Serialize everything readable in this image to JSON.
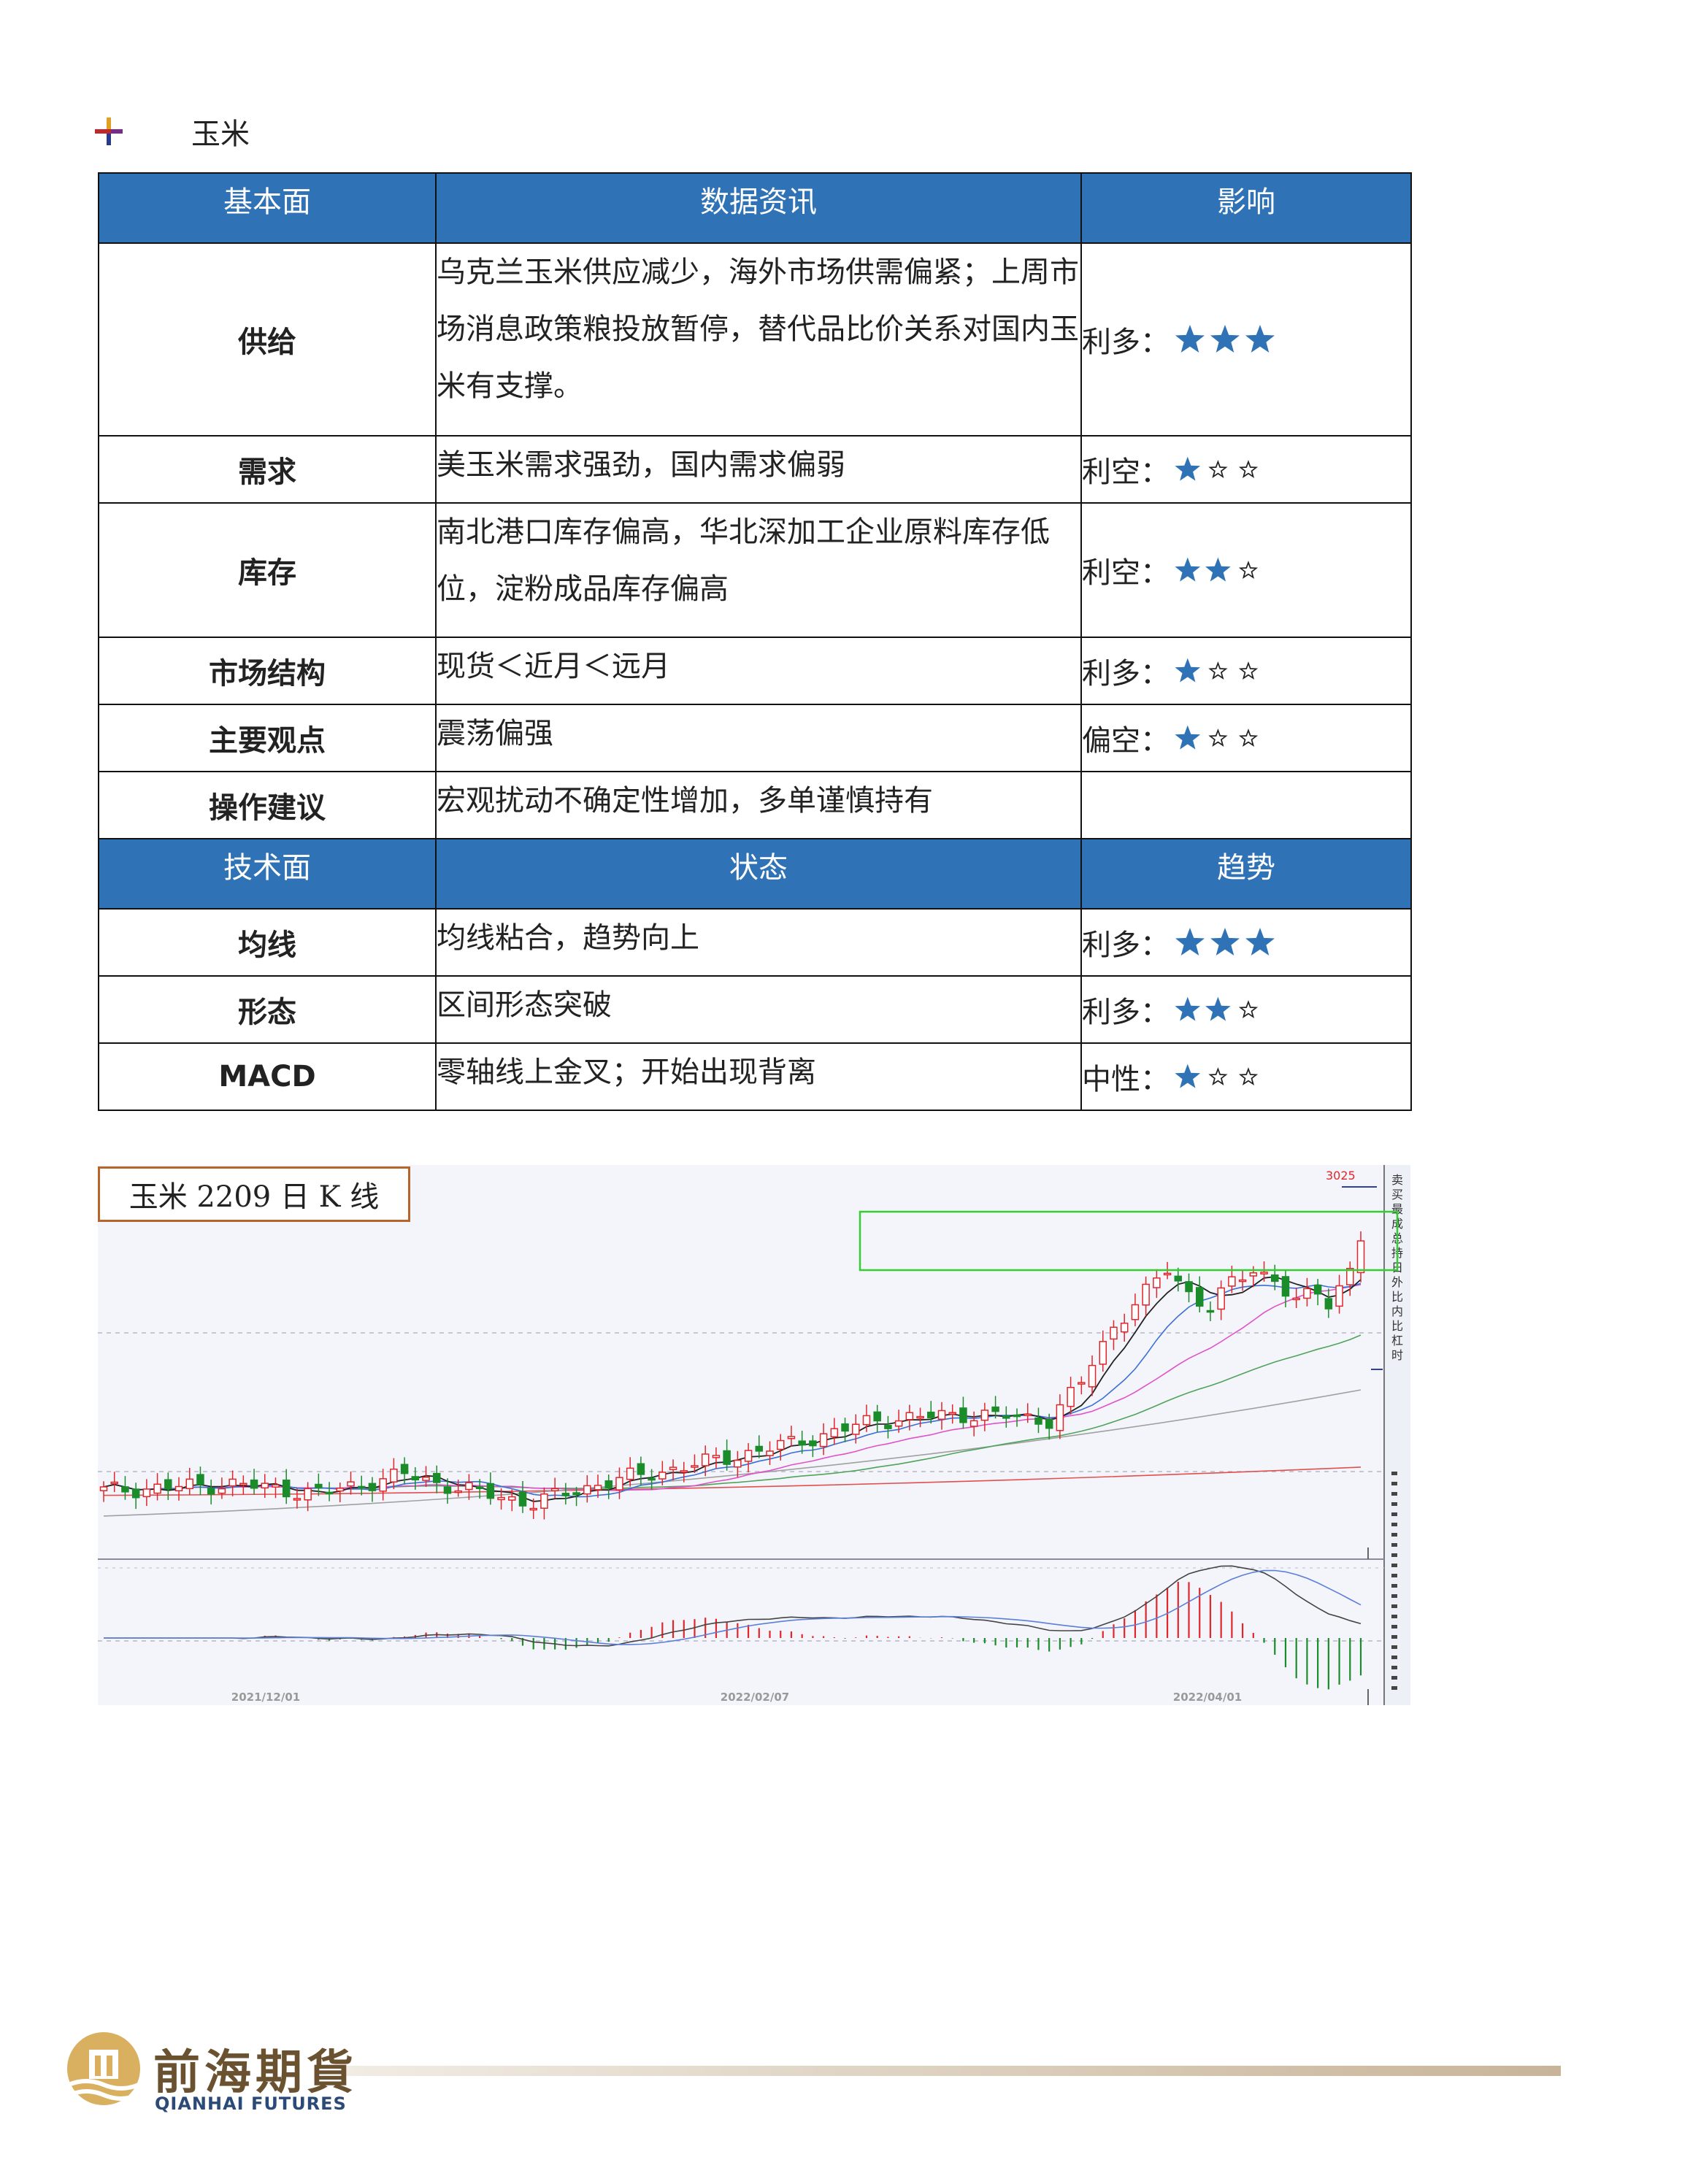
{
  "section": {
    "title": "玉米"
  },
  "table": {
    "header1": [
      "基本面",
      "数据资讯",
      "影响"
    ],
    "rows1": [
      {
        "cat": "供给",
        "info": "乌克兰玉米供应减少，海外市场供需偏紧；上周市场消息政策粮投放暂停，替代品比价关系对国内玉米有支撑。",
        "impact": "利多：",
        "stars": 3
      },
      {
        "cat": "需求",
        "info": "美玉米需求强劲，国内需求偏弱",
        "impact": "利空：",
        "stars": 1
      },
      {
        "cat": "库存",
        "info": "南北港口库存偏高，华北深加工企业原料库存低位，淀粉成品库存偏高",
        "impact": "利空：",
        "stars": 2
      },
      {
        "cat": "市场结构",
        "info": "现货＜近月＜远月",
        "impact": "利多：",
        "stars": 1
      },
      {
        "cat": "主要观点",
        "info": "震荡偏强",
        "impact": "偏空：",
        "stars": 1
      },
      {
        "cat": "操作建议",
        "info": "宏观扰动不确定性增加，多单谨慎持有",
        "impact": "",
        "stars": 0
      }
    ],
    "header2": [
      "技术面",
      "状态",
      "趋势"
    ],
    "rows2": [
      {
        "cat": "均线",
        "info": "均线粘合，趋势向上",
        "impact": "利多：",
        "stars": 3
      },
      {
        "cat": "形态",
        "info": "区间形态突破",
        "impact": "利多：",
        "stars": 2
      },
      {
        "cat": "MACD",
        "info": "零轴线上金叉；开始出现背离",
        "impact": "中性：",
        "stars": 1
      }
    ]
  },
  "chart": {
    "title": "玉米 2209 日 K 线",
    "peak_label": "3025",
    "x_labels": [
      "2021/12/01",
      "2022/02/07",
      "2022/04/01"
    ],
    "side_labels": [
      "卖",
      "买",
      "最",
      "成",
      "总",
      "持",
      "日",
      "外",
      "比",
      "内",
      "比",
      "杠",
      "时"
    ],
    "colors": {
      "up": "#e0262b",
      "down": "#1a8c2a",
      "ma5": "#222222",
      "ma10": "#3b6fd8",
      "ma20": "#e052c8",
      "ma40": "#4fa35a",
      "ma60": "#a0a0a0",
      "ma120": "#e05050",
      "box": "#33cc33"
    }
  },
  "footer": {
    "logo_cn": "前海期貨",
    "logo_en": "QIANHAI FUTURES"
  }
}
